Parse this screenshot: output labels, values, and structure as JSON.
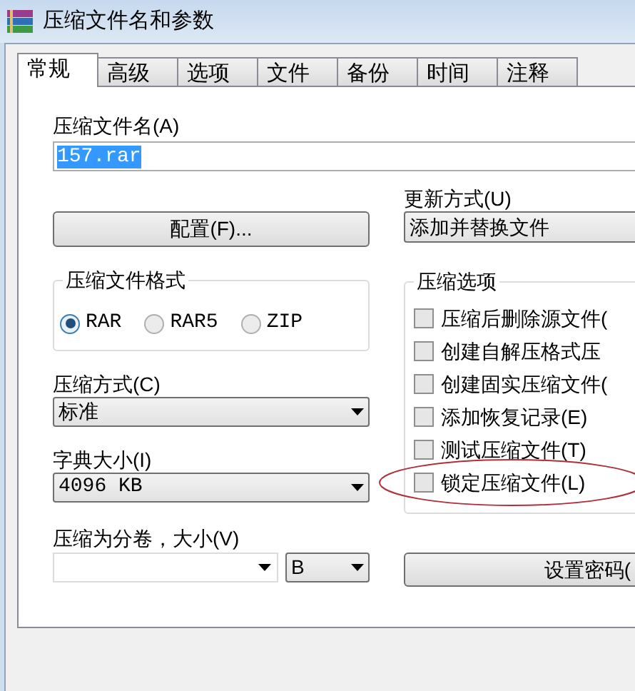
{
  "window": {
    "title": "压缩文件名和参数"
  },
  "tabs": [
    {
      "label": "常规",
      "selected": true
    },
    {
      "label": "高级",
      "selected": false
    },
    {
      "label": "选项",
      "selected": false
    },
    {
      "label": "文件",
      "selected": false
    },
    {
      "label": "备份",
      "selected": false
    },
    {
      "label": "时间",
      "selected": false
    },
    {
      "label": "注释",
      "selected": false
    }
  ],
  "archive_name": {
    "label": "压缩文件名(A)",
    "value": "157.rar"
  },
  "profiles_button": "配置(F)...",
  "update_mode": {
    "label": "更新方式(U)",
    "value": "添加并替换文件"
  },
  "archive_format": {
    "title": "压缩文件格式",
    "options": [
      {
        "label": "RAR",
        "selected": true
      },
      {
        "label": "RAR5",
        "selected": false
      },
      {
        "label": "ZIP",
        "selected": false
      }
    ]
  },
  "compression_method": {
    "label": "压缩方式(C)",
    "value": "标准"
  },
  "dictionary_size": {
    "label": "字典大小(I)",
    "value": "4096 KB"
  },
  "split_volumes": {
    "label": "压缩为分卷，大小(V)",
    "unit": "B"
  },
  "archiving_options": {
    "title": "压缩选项",
    "options": [
      {
        "label": "压缩后删除源文件(",
        "checked": false,
        "highlighted": false
      },
      {
        "label": "创建自解压格式压",
        "checked": false,
        "highlighted": false
      },
      {
        "label": "创建固实压缩文件(",
        "checked": false,
        "highlighted": false
      },
      {
        "label": "添加恢复记录(E)",
        "checked": false,
        "highlighted": false
      },
      {
        "label": "测试压缩文件(T)",
        "checked": false,
        "highlighted": false
      },
      {
        "label": "锁定压缩文件(L)",
        "checked": false,
        "highlighted": true
      }
    ]
  },
  "password_button": "设置密码("
}
